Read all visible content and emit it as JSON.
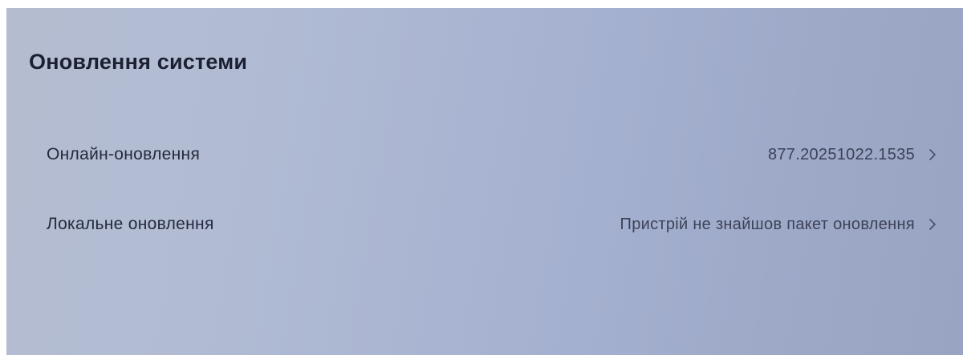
{
  "page": {
    "title": "Оновлення системи"
  },
  "rows": [
    {
      "label": "Онлайн-оновлення",
      "value": "877.20251022.1535",
      "icon": "chevron-right-icon"
    },
    {
      "label": "Локальне оновлення",
      "value": "Пристрій не знайшов пакет оновлення",
      "icon": "chevron-right-icon"
    }
  ],
  "colors": {
    "background": "#aab5d2",
    "title_text": "#1c2033",
    "label_text": "#252a3e",
    "value_text": "#3c4258"
  }
}
